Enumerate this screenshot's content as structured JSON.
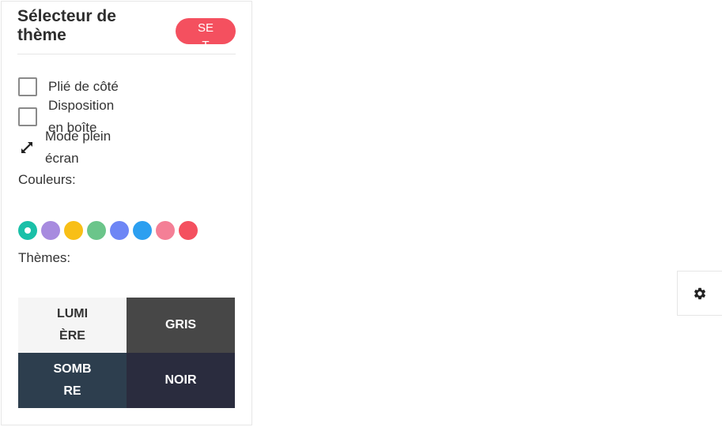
{
  "panel": {
    "title": "Sélecteur de thème",
    "reset_label": "RESET"
  },
  "options": {
    "collapsed_side": "Plié de côté",
    "boxed_layout": "Disposition en boîte",
    "fullscreen": "Mode plein écran"
  },
  "colors": {
    "label": "Couleurs:",
    "swatches": [
      "#1ac0a8",
      "#a78bdf",
      "#f8bf17",
      "#6bc58a",
      "#6e86f5",
      "#2c9ff0",
      "#f47f96",
      "#f4505f"
    ],
    "selected_index": 0
  },
  "themes": {
    "label": "Thèmes:",
    "items": [
      {
        "label": "LUMIÈRE",
        "bg": "#f5f5f5",
        "fg": "#333333"
      },
      {
        "label": "GRIS",
        "bg": "#474747",
        "fg": "#ffffff"
      },
      {
        "label": "SOMBRE",
        "bg": "#2d3e4e",
        "fg": "#ffffff"
      },
      {
        "label": "NOIR",
        "bg": "#2a2c3e",
        "fg": "#ffffff"
      }
    ]
  },
  "icons": {
    "fullscreen": "expand-icon",
    "settings": "gear-icon"
  }
}
